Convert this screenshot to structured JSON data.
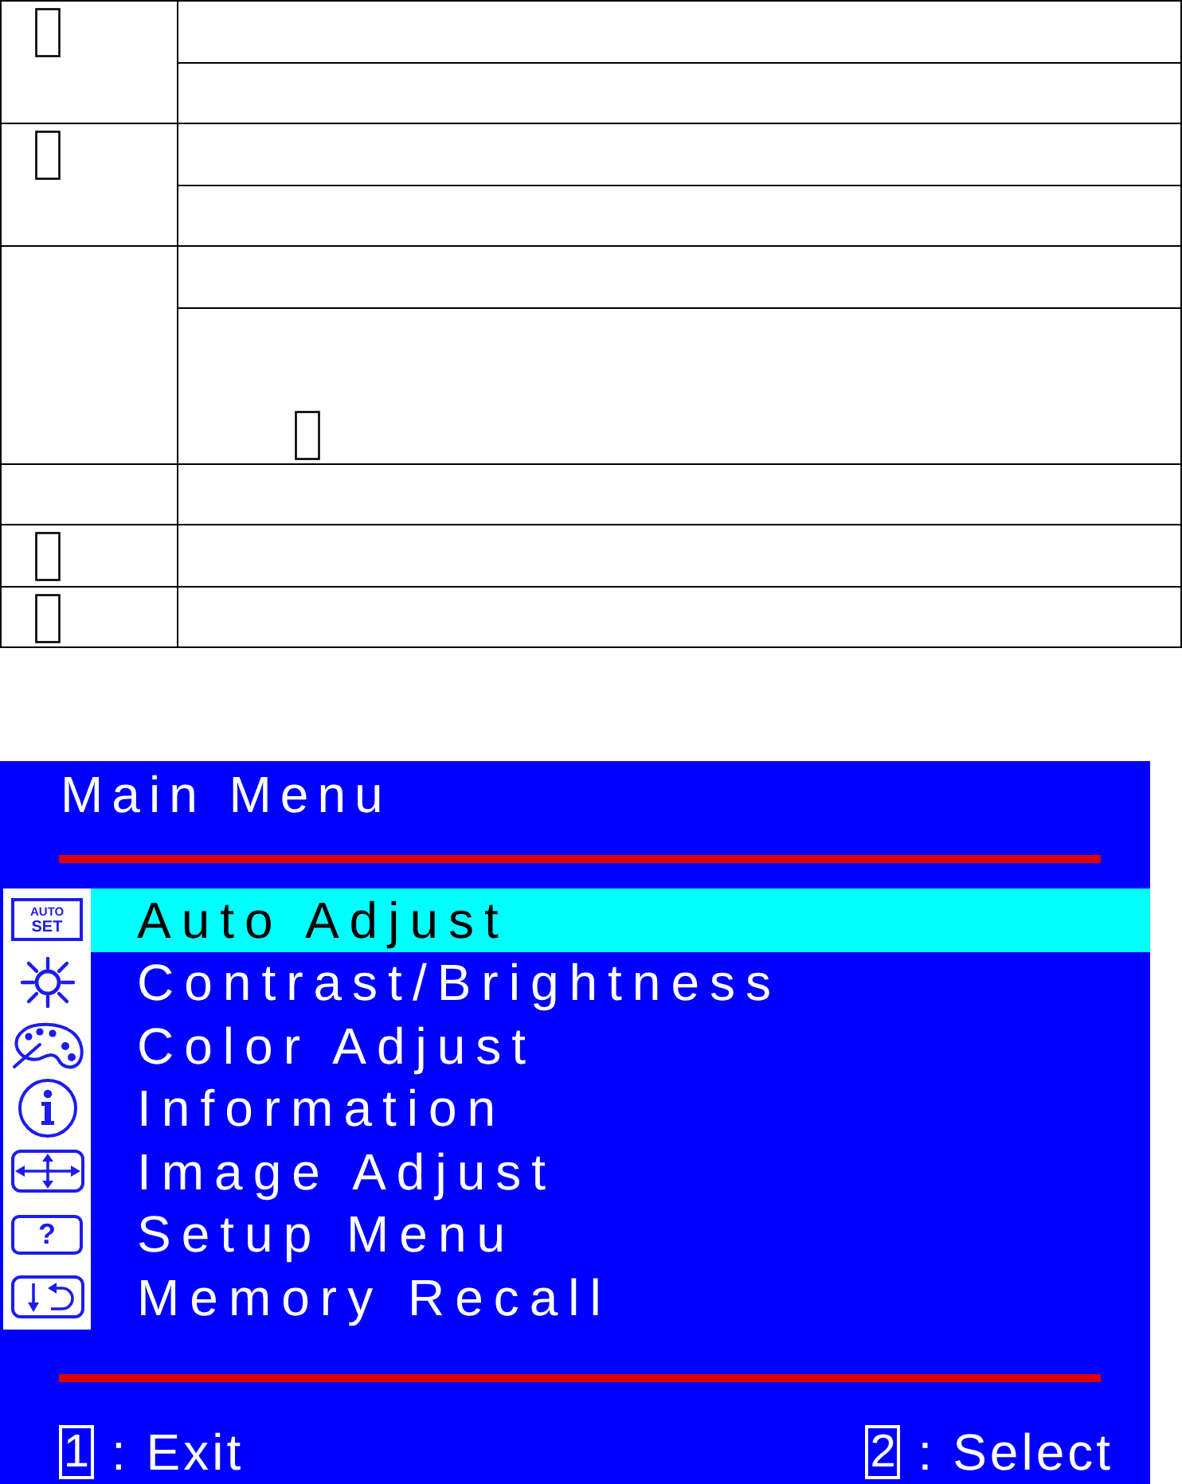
{
  "table": {
    "groups": [
      {
        "glyph": true,
        "rows": [
          {
            "glyph": false
          },
          {
            "glyph": false
          }
        ]
      },
      {
        "glyph": true,
        "rows": [
          {
            "glyph": false
          },
          {
            "glyph": false
          }
        ]
      },
      {
        "glyph": false,
        "rows": [
          {
            "glyph": false
          },
          {
            "glyph": true
          }
        ]
      },
      {
        "glyph": false,
        "rows": [
          {
            "glyph": false
          }
        ]
      },
      {
        "glyph": true,
        "rows": [
          {
            "glyph": false
          }
        ]
      },
      {
        "glyph": true,
        "rows": [
          {
            "glyph": false
          }
        ]
      }
    ]
  },
  "menu": {
    "title": "Main Menu",
    "items": [
      {
        "kind": "autoset",
        "icon_text": "AUTO SET",
        "label": "Auto Adjust",
        "selected": true
      },
      {
        "kind": "brightness",
        "label": "Contrast/Brightness",
        "selected": false
      },
      {
        "kind": "color",
        "label": "Color Adjust",
        "selected": false
      },
      {
        "kind": "information",
        "label": "Information",
        "selected": false
      },
      {
        "kind": "image",
        "label": "Image Adjust",
        "selected": false
      },
      {
        "kind": "setup",
        "icon_text": "?",
        "label": "Setup Menu",
        "selected": false
      },
      {
        "kind": "recall",
        "label": "Memory Recall",
        "selected": false
      }
    ],
    "footer": [
      {
        "key": "1",
        "label": ": Exit"
      },
      {
        "key": "2",
        "label": ": Select"
      }
    ]
  }
}
